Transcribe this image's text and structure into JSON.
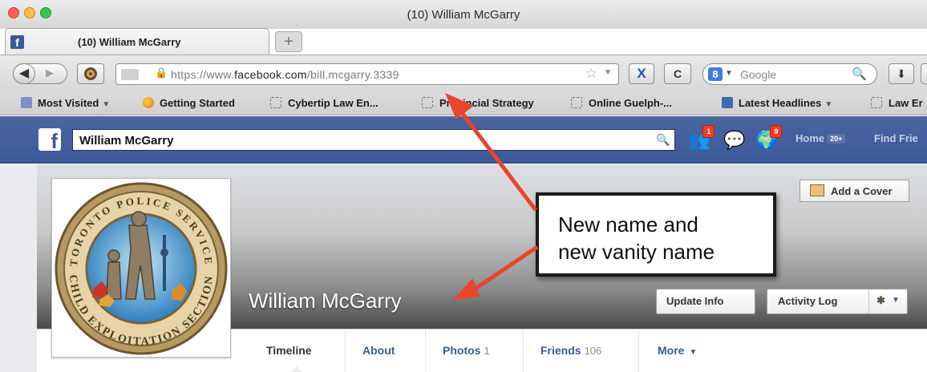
{
  "window": {
    "title": "(10) William McGarry"
  },
  "tab": {
    "title": "(10) William McGarry",
    "favicon": "f",
    "new_tab": "+"
  },
  "toolbar": {
    "url_prefix": "https://www.",
    "url_domain": "facebook.com",
    "url_path": "/bill.mcgarry.3339",
    "search_badge": "8",
    "search_engine": "Google",
    "x_label": "X",
    "c_label": "C"
  },
  "bookmarks": [
    {
      "label": "Most Visited",
      "dropdown": true,
      "icon": "folder-icon"
    },
    {
      "label": "Getting Started",
      "dropdown": false,
      "icon": "firefox-icon"
    },
    {
      "label": "Cybertip Law En...",
      "dropdown": false,
      "icon": "page-icon"
    },
    {
      "label": "Provincial Strategy",
      "dropdown": false,
      "icon": "page-icon"
    },
    {
      "label": "Online Guelph-...",
      "dropdown": false,
      "icon": "page-icon"
    },
    {
      "label": "Latest Headlines",
      "dropdown": true,
      "icon": "rss-icon"
    },
    {
      "label": "Law Er",
      "dropdown": false,
      "icon": "page-icon"
    }
  ],
  "facebook": {
    "logo": "f",
    "search_value": "William McGarry",
    "friend_requests_count": "1",
    "notifications_count": "9",
    "home_label": "Home",
    "home_badge": "20+",
    "find_friends_label": "Find Frie"
  },
  "profile": {
    "name": "William McGarry",
    "add_cover": "Add a Cover",
    "update_info": "Update Info",
    "activity_log": "Activity Log",
    "seal_top_text": "TORONTO POLICE SERVICE",
    "seal_bottom_text": "CHILD EXPLOITATION SECTION"
  },
  "profile_tabs": [
    {
      "label": "Timeline",
      "count": ""
    },
    {
      "label": "About",
      "count": ""
    },
    {
      "label": "Photos",
      "count": "1"
    },
    {
      "label": "Friends",
      "count": "106"
    },
    {
      "label": "More",
      "count": ""
    }
  ],
  "annotation": {
    "line1": "New name and",
    "line2": "new vanity name"
  },
  "colors": {
    "facebook_blue": "#3b5998",
    "annotation_arrow": "#e8452c",
    "notification_red": "#f03d25"
  }
}
